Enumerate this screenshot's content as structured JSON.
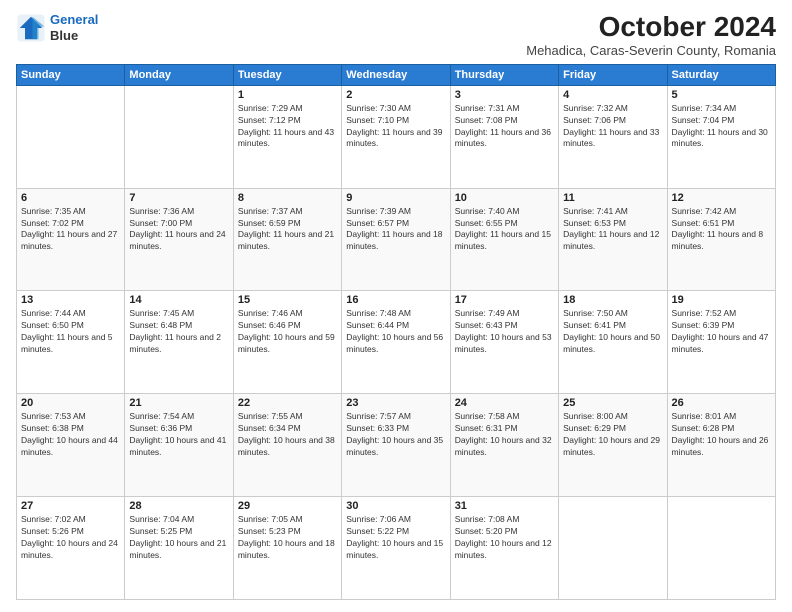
{
  "header": {
    "logo_line1": "General",
    "logo_line2": "Blue",
    "title": "October 2024",
    "subtitle": "Mehadica, Caras-Severin County, Romania"
  },
  "columns": [
    "Sunday",
    "Monday",
    "Tuesday",
    "Wednesday",
    "Thursday",
    "Friday",
    "Saturday"
  ],
  "weeks": [
    [
      {
        "day": "",
        "content": ""
      },
      {
        "day": "",
        "content": ""
      },
      {
        "day": "1",
        "content": "Sunrise: 7:29 AM\nSunset: 7:12 PM\nDaylight: 11 hours and 43 minutes."
      },
      {
        "day": "2",
        "content": "Sunrise: 7:30 AM\nSunset: 7:10 PM\nDaylight: 11 hours and 39 minutes."
      },
      {
        "day": "3",
        "content": "Sunrise: 7:31 AM\nSunset: 7:08 PM\nDaylight: 11 hours and 36 minutes."
      },
      {
        "day": "4",
        "content": "Sunrise: 7:32 AM\nSunset: 7:06 PM\nDaylight: 11 hours and 33 minutes."
      },
      {
        "day": "5",
        "content": "Sunrise: 7:34 AM\nSunset: 7:04 PM\nDaylight: 11 hours and 30 minutes."
      }
    ],
    [
      {
        "day": "6",
        "content": "Sunrise: 7:35 AM\nSunset: 7:02 PM\nDaylight: 11 hours and 27 minutes."
      },
      {
        "day": "7",
        "content": "Sunrise: 7:36 AM\nSunset: 7:00 PM\nDaylight: 11 hours and 24 minutes."
      },
      {
        "day": "8",
        "content": "Sunrise: 7:37 AM\nSunset: 6:59 PM\nDaylight: 11 hours and 21 minutes."
      },
      {
        "day": "9",
        "content": "Sunrise: 7:39 AM\nSunset: 6:57 PM\nDaylight: 11 hours and 18 minutes."
      },
      {
        "day": "10",
        "content": "Sunrise: 7:40 AM\nSunset: 6:55 PM\nDaylight: 11 hours and 15 minutes."
      },
      {
        "day": "11",
        "content": "Sunrise: 7:41 AM\nSunset: 6:53 PM\nDaylight: 11 hours and 12 minutes."
      },
      {
        "day": "12",
        "content": "Sunrise: 7:42 AM\nSunset: 6:51 PM\nDaylight: 11 hours and 8 minutes."
      }
    ],
    [
      {
        "day": "13",
        "content": "Sunrise: 7:44 AM\nSunset: 6:50 PM\nDaylight: 11 hours and 5 minutes."
      },
      {
        "day": "14",
        "content": "Sunrise: 7:45 AM\nSunset: 6:48 PM\nDaylight: 11 hours and 2 minutes."
      },
      {
        "day": "15",
        "content": "Sunrise: 7:46 AM\nSunset: 6:46 PM\nDaylight: 10 hours and 59 minutes."
      },
      {
        "day": "16",
        "content": "Sunrise: 7:48 AM\nSunset: 6:44 PM\nDaylight: 10 hours and 56 minutes."
      },
      {
        "day": "17",
        "content": "Sunrise: 7:49 AM\nSunset: 6:43 PM\nDaylight: 10 hours and 53 minutes."
      },
      {
        "day": "18",
        "content": "Sunrise: 7:50 AM\nSunset: 6:41 PM\nDaylight: 10 hours and 50 minutes."
      },
      {
        "day": "19",
        "content": "Sunrise: 7:52 AM\nSunset: 6:39 PM\nDaylight: 10 hours and 47 minutes."
      }
    ],
    [
      {
        "day": "20",
        "content": "Sunrise: 7:53 AM\nSunset: 6:38 PM\nDaylight: 10 hours and 44 minutes."
      },
      {
        "day": "21",
        "content": "Sunrise: 7:54 AM\nSunset: 6:36 PM\nDaylight: 10 hours and 41 minutes."
      },
      {
        "day": "22",
        "content": "Sunrise: 7:55 AM\nSunset: 6:34 PM\nDaylight: 10 hours and 38 minutes."
      },
      {
        "day": "23",
        "content": "Sunrise: 7:57 AM\nSunset: 6:33 PM\nDaylight: 10 hours and 35 minutes."
      },
      {
        "day": "24",
        "content": "Sunrise: 7:58 AM\nSunset: 6:31 PM\nDaylight: 10 hours and 32 minutes."
      },
      {
        "day": "25",
        "content": "Sunrise: 8:00 AM\nSunset: 6:29 PM\nDaylight: 10 hours and 29 minutes."
      },
      {
        "day": "26",
        "content": "Sunrise: 8:01 AM\nSunset: 6:28 PM\nDaylight: 10 hours and 26 minutes."
      }
    ],
    [
      {
        "day": "27",
        "content": "Sunrise: 7:02 AM\nSunset: 5:26 PM\nDaylight: 10 hours and 24 minutes."
      },
      {
        "day": "28",
        "content": "Sunrise: 7:04 AM\nSunset: 5:25 PM\nDaylight: 10 hours and 21 minutes."
      },
      {
        "day": "29",
        "content": "Sunrise: 7:05 AM\nSunset: 5:23 PM\nDaylight: 10 hours and 18 minutes."
      },
      {
        "day": "30",
        "content": "Sunrise: 7:06 AM\nSunset: 5:22 PM\nDaylight: 10 hours and 15 minutes."
      },
      {
        "day": "31",
        "content": "Sunrise: 7:08 AM\nSunset: 5:20 PM\nDaylight: 10 hours and 12 minutes."
      },
      {
        "day": "",
        "content": ""
      },
      {
        "day": "",
        "content": ""
      }
    ]
  ]
}
